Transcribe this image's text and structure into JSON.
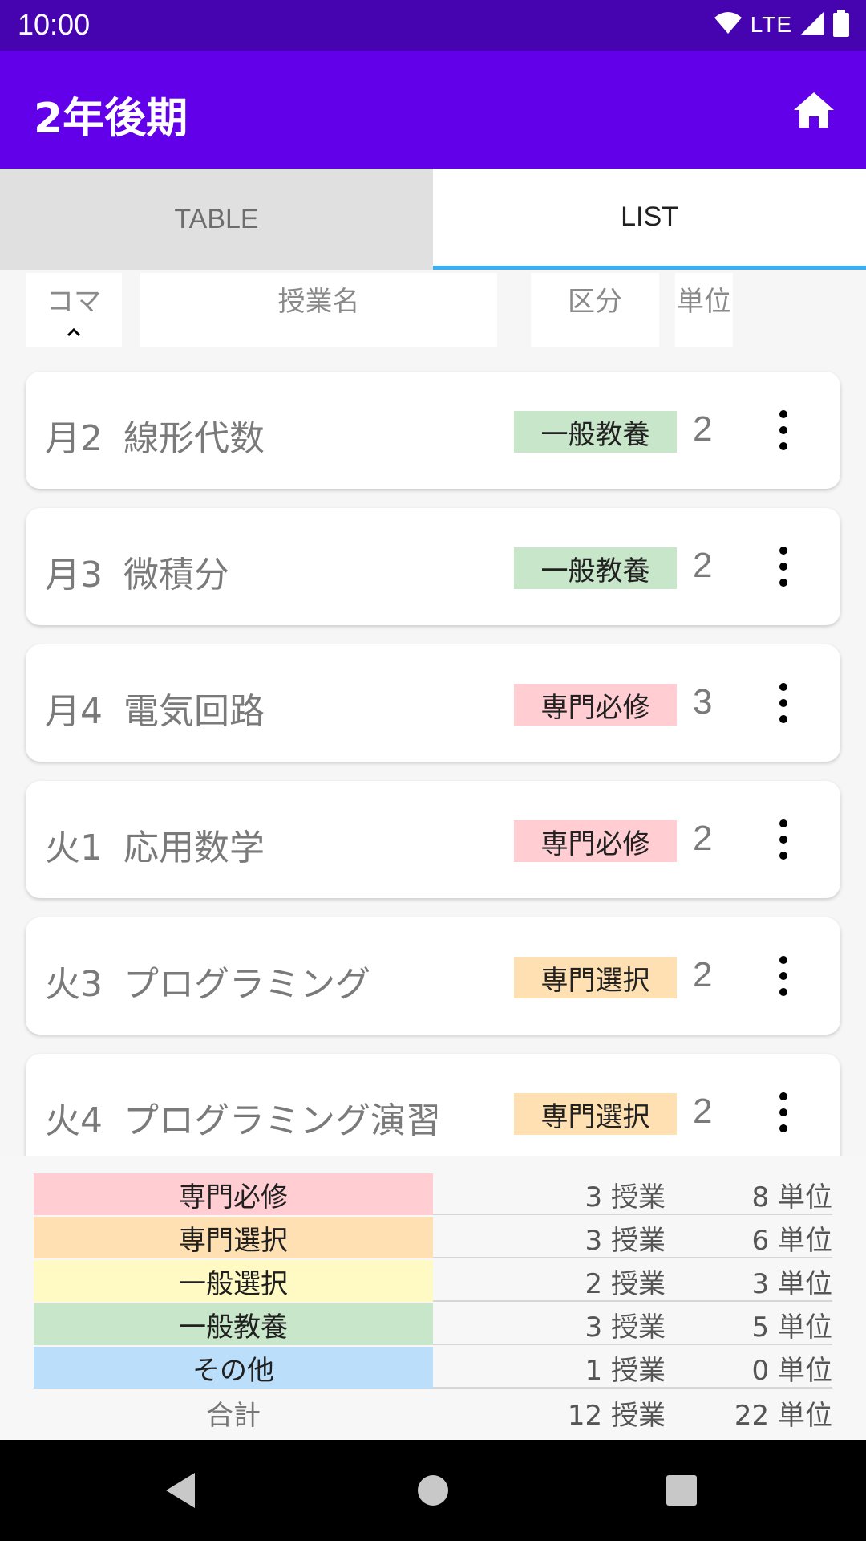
{
  "status_bar": {
    "time": "10:00",
    "network": "LTE",
    "icons": [
      "wifi-icon",
      "signal-icon",
      "battery-icon"
    ]
  },
  "app_bar": {
    "title": "2年後期",
    "home_icon": "home-icon"
  },
  "tabs": [
    {
      "label": "TABLE",
      "active": false
    },
    {
      "label": "LIST",
      "active": true
    }
  ],
  "columns": {
    "koma": "コマ",
    "name": "授業名",
    "kubun": "区分",
    "tani": "単位",
    "sort_icon": "chevron-up-icon"
  },
  "classes": [
    {
      "koma": "月2",
      "name": "線形代数",
      "category": "一般教養",
      "credits": "2"
    },
    {
      "koma": "月3",
      "name": "微積分",
      "category": "一般教養",
      "credits": "2"
    },
    {
      "koma": "月4",
      "name": "電気回路",
      "category": "専門必修",
      "credits": "3"
    },
    {
      "koma": "火1",
      "name": "応用数学",
      "category": "専門必修",
      "credits": "2"
    },
    {
      "koma": "火3",
      "name": "プログラミング",
      "category": "専門選択",
      "credits": "2"
    },
    {
      "koma": "火4",
      "name": "プログラミング演習",
      "category": "専門選択",
      "credits": "2"
    }
  ],
  "summary": {
    "rows": [
      {
        "category": "専門必修",
        "classes": "3 授業",
        "credits": "8 単位"
      },
      {
        "category": "専門選択",
        "classes": "3 授業",
        "credits": "6 単位"
      },
      {
        "category": "一般選択",
        "classes": "2 授業",
        "credits": "3 単位"
      },
      {
        "category": "一般教養",
        "classes": "3 授業",
        "credits": "5 単位"
      },
      {
        "category": "その他",
        "classes": "1 授業",
        "credits": "0 単位"
      }
    ],
    "total": {
      "label": "合計",
      "classes": "12 授業",
      "credits": "22 単位"
    }
  },
  "colors": {
    "status_bar": "#4604b0",
    "app_bar": "#6200ea",
    "tab_indicator": "#39aef0",
    "専門必修": "#ffcdd2",
    "専門選択": "#ffe0b2",
    "一般選択": "#fff9c4",
    "一般教養": "#c8e6c9",
    "その他": "#bbdefb"
  },
  "nav_bar": {
    "icons": [
      "back-icon",
      "home-circle-icon",
      "recents-icon"
    ]
  }
}
